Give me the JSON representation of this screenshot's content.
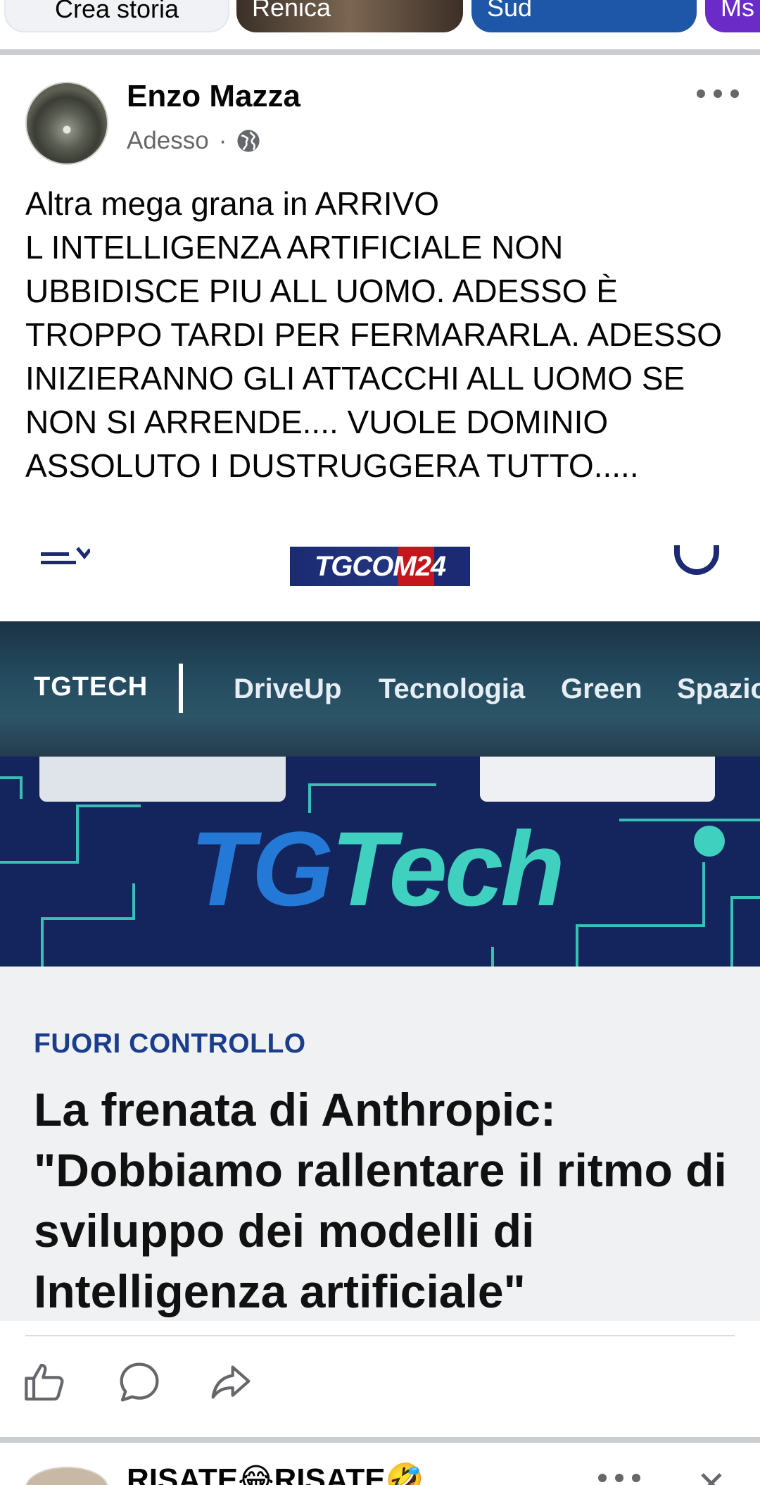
{
  "stories": {
    "items": [
      {
        "label": "Crea storia"
      },
      {
        "label": "Renica"
      },
      {
        "label": "Sud"
      },
      {
        "label": "Ms"
      }
    ]
  },
  "post": {
    "author": "Enzo Mazza",
    "time": "Adesso",
    "separator": "·",
    "privacy_icon": "globe-icon",
    "more_icon": "more-options-icon",
    "text": "Altra mega grana in ARRIVO\nL INTELLIGENZA ARTIFICIALE NON UBBIDISCE PIU ALL UOMO. ADESSO È TROPPO TARDI PER FERMARARLA. ADESSO INIZIERANNO GLI ATTACCHI ALL UOMO SE NON SI ARRENDE.... VUOLE DOMINIO ASSOLUTO I DUSTRUGGERA TUTTO....."
  },
  "shared_image": {
    "logo": "TGCOM24",
    "nav": {
      "brand": "TGTECH",
      "items": [
        "DriveUp",
        "Tecnologia",
        "Green",
        "Spazio"
      ]
    },
    "banner": {
      "tg": "TG",
      "tech": "Tech"
    },
    "kicker": "FUORI CONTROLLO",
    "headline": "La frenata di Anthropic: \"Dobbiamo rallentare il ritmo di sviluppo dei modelli di Intelligenza artificiale\""
  },
  "actions": {
    "like_icon": "like-icon",
    "comment_icon": "comment-icon",
    "share_icon": "share-icon"
  },
  "next_post": {
    "title": "RISATE😂RISATE🤣",
    "close_icon": "close-icon"
  },
  "colors": {
    "accent": "#1b3e8c",
    "tg_blue": "#2479d6",
    "tech_teal": "#3fd0bf",
    "banner_bg": "#14245c"
  }
}
